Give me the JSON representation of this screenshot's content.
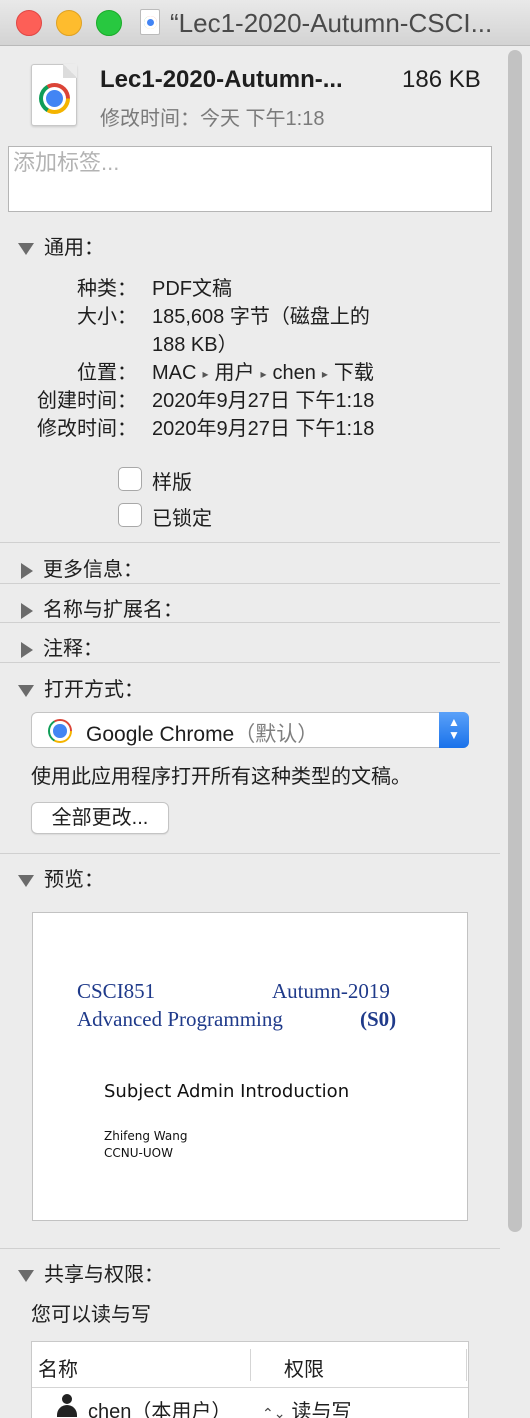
{
  "window": {
    "title": "“Lec1-2020-Autumn-CSCI..."
  },
  "header": {
    "file_name": "Lec1-2020-Autumn-...",
    "file_size": "186 KB",
    "modified": "修改时间：今天 下午1:18"
  },
  "tags": {
    "placeholder": "添加标签..."
  },
  "general": {
    "title": "通用：",
    "kind_label": "种类：",
    "kind_value": "PDF文稿",
    "size_label": "大小：",
    "size_value_1": "185,608 字节（磁盘上的",
    "size_value_2": "188 KB）",
    "where_label": "位置：",
    "where_path": [
      "MAC",
      "用户",
      "chen",
      "下载"
    ],
    "created_label": "创建时间：",
    "created_value": "2020年9月27日 下午1:18",
    "modified_label": "修改时间：",
    "modified_value": "2020年9月27日 下午1:18",
    "stationery_label": "样版",
    "locked_label": "已锁定"
  },
  "more_info": {
    "title": "更多信息："
  },
  "name_ext": {
    "title": "名称与扩展名："
  },
  "comments": {
    "title": "注释："
  },
  "open_with": {
    "title": "打开方式：",
    "app": "Google Chrome",
    "app_suffix": "（默认）",
    "description": "使用此应用程序打开所有这种类型的文稿。",
    "change_all": "全部更改..."
  },
  "preview": {
    "title": "预览：",
    "course_code": "CSCI851",
    "term": "Autumn-2019",
    "course_name": "Advanced Programming",
    "session": "(S0)",
    "subject": "Subject Admin Introduction",
    "author": "Zhifeng Wang",
    "org": "CCNU-UOW"
  },
  "sharing": {
    "title": "共享与权限：",
    "summary": "您可以读与写",
    "col_name": "名称",
    "col_perm": "权限",
    "rows": [
      {
        "name": "chen（本用户）",
        "perm": "读与写"
      }
    ]
  },
  "icons": [
    "chrome-icon",
    "user-icon",
    "disclosure-triangle-icon",
    "popup-stepper-icon"
  ],
  "colors": {
    "accent": "#1a72ea",
    "close": "#fd5f57",
    "minimize": "#febc2e",
    "maximize": "#28c840"
  }
}
